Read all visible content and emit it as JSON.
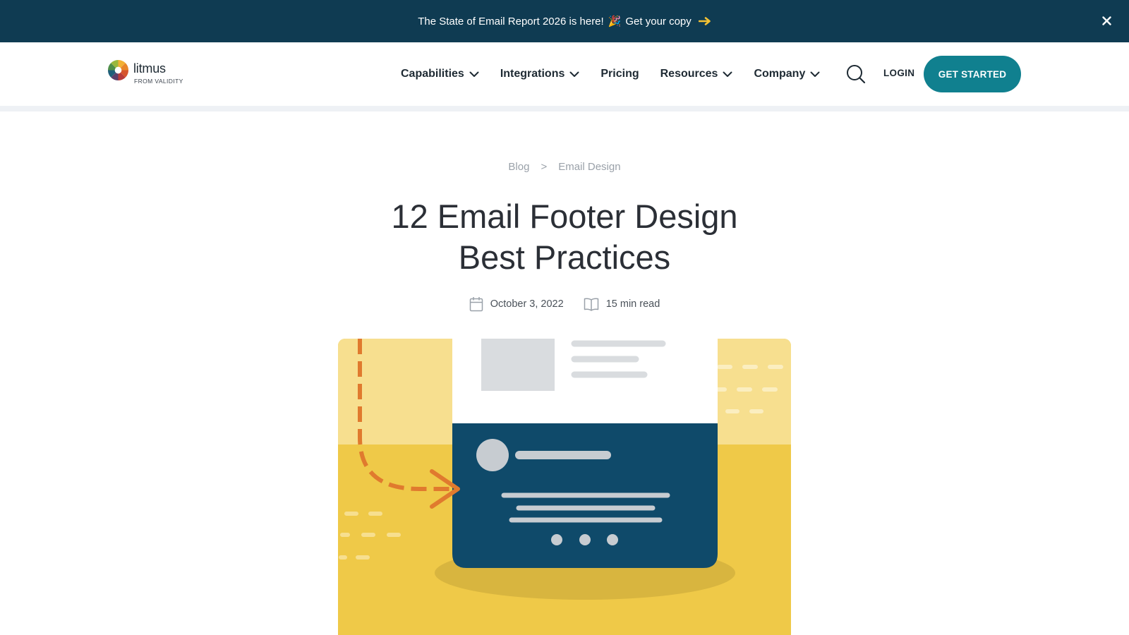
{
  "announcement": {
    "text": "The State of Email Report 2026 is here!",
    "emoji": "🎉",
    "link_text": "Get your copy",
    "arrow_icon": "right-arrow-icon",
    "close_icon": "close-icon",
    "background": "#0f3b52"
  },
  "header": {
    "logo": {
      "word": "litmus",
      "sub": "FROM VALIDITY"
    },
    "nav": [
      {
        "label": "Capabilities",
        "has_dropdown": true
      },
      {
        "label": "Integrations",
        "has_dropdown": true
      },
      {
        "label": "Pricing",
        "has_dropdown": false
      },
      {
        "label": "Resources",
        "has_dropdown": true
      },
      {
        "label": "Company",
        "has_dropdown": true
      }
    ],
    "search_icon": "search-icon",
    "login_label": "LOGIN",
    "cta_label": "GET STARTED",
    "cta_color": "#10808f"
  },
  "breadcrumb": {
    "items": [
      "Blog",
      "Email Design"
    ],
    "separator": ">"
  },
  "article": {
    "title_line1": "12 Email Footer Design",
    "title_line2": "Best Practices",
    "date": "October 3, 2022",
    "date_icon": "calendar-icon",
    "read_time": "15 min read",
    "read_icon": "book-icon"
  },
  "hero": {
    "image": "email-footer-illustration",
    "colors": {
      "yellow_light": "#f7df8f",
      "yellow": "#efc948",
      "navy": "#0f4a6a",
      "orange": "#e07a2e"
    }
  }
}
